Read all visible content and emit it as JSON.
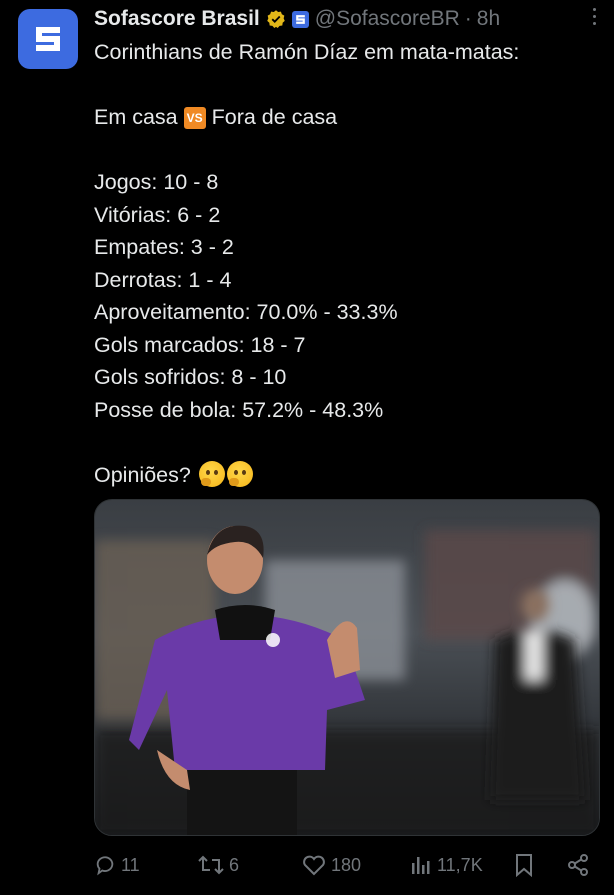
{
  "tweet": {
    "author_name": "Sofascore Brasil",
    "handle": "@SofascoreBR",
    "separator": "·",
    "time": "8h",
    "lines": [
      "Corinthians de Ramón Díaz em mata-matas:",
      "",
      "Em casa",
      "",
      "Jogos: 10 - 8",
      "Vitórias: 6 - 2",
      "Empates: 3 - 2",
      "Derrotas: 1 - 4",
      "Aproveitamento: 70.0% - 33.3%",
      "Gols marcados: 18 - 7",
      "Gols sofridos: 8 - 10",
      "Posse de bola: 57.2% - 48.3%",
      "",
      "Opiniões?"
    ],
    "home_label": "Em casa",
    "vs_badge": "VS",
    "away_label": "Fora de casa",
    "question": "Opiniões?",
    "emojis": [
      "thinking-face",
      "thinking-face"
    ]
  },
  "actions": {
    "replies": "11",
    "reposts": "6",
    "likes": "180",
    "views": "11,7K"
  },
  "colors": {
    "background": "#000000",
    "text": "#e7e9ea",
    "muted": "#71767b",
    "brand_blue": "#3d6be0",
    "verified_gold": "#e2b719",
    "vs_orange": "#f08a24",
    "jacket_purple": "#6a3aa8"
  },
  "icons": [
    "sofascore-logo-icon",
    "verified-badge-icon",
    "affiliate-badge-icon",
    "more-icon",
    "reply-icon",
    "repost-icon",
    "like-icon",
    "views-icon",
    "bookmark-icon",
    "share-icon"
  ]
}
